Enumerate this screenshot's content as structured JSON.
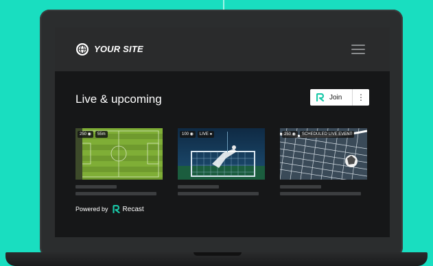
{
  "header": {
    "site_name": "YOUR SITE",
    "logo_icon": "globe-icon",
    "menu_icon": "hamburger-menu-icon"
  },
  "main": {
    "section_title": "Live & upcoming",
    "join": {
      "label": "Join",
      "icon": "recast-logo-icon",
      "more_label": "⋮"
    },
    "cards": [
      {
        "viewers": "250",
        "badge": "55m",
        "image": "soccer-field-aerial"
      },
      {
        "viewers": "100",
        "badge": "LIVE",
        "image": "goalkeeper-dive"
      },
      {
        "viewers": "250",
        "badge": "SCHEDULED LIVE EVENT",
        "image": "ball-in-net"
      }
    ]
  },
  "footer": {
    "powered_by": "Powered by",
    "brand": "Recast"
  },
  "colors": {
    "background": "#19dec0",
    "screen": "#161718",
    "header": "#2a2b2c",
    "accent": "#19c8a8"
  }
}
